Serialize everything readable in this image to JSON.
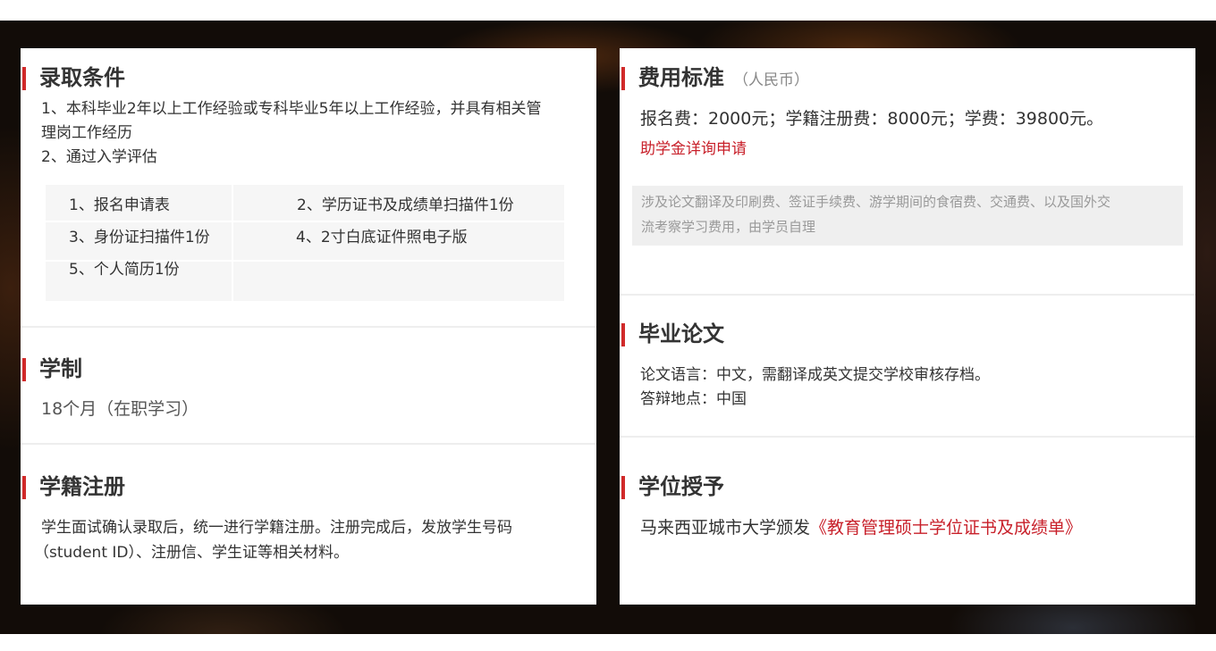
{
  "left": {
    "admission": {
      "title": "录取条件",
      "lines": [
        "1、本科毕业2年以上工作经验或专科毕业5年以上工作经验，并具有相关管",
        "理岗工作经历",
        "2、通过入学评估"
      ],
      "materials": [
        "1、报名申请表",
        "2、学历证书及成绩单扫描件1份",
        "3、身份证扫描件1份",
        "4、2寸白底证件照电子版",
        "5、个人简历1份"
      ]
    },
    "duration": {
      "title": "学制",
      "text": "18个月（在职学习）"
    },
    "registration": {
      "title": "学籍注册",
      "lines": [
        "学生面试确认录取后，统一进行学籍注册。注册完成后，发放学生号码",
        "（student ID）、注册信、学生证等相关材料。"
      ]
    }
  },
  "right": {
    "fees": {
      "title": "费用标准",
      "subtitle": "（人民币）",
      "line": "报名费：2000元；学籍注册费：8000元；学费：39800元。",
      "scholarship_link": "助学金详询申请",
      "note_lines": [
        "涉及论文翻译及印刷费、签证手续费、游学期间的食宿费、交通费、以及国外交",
        "流考察学习费用，由学员自理"
      ]
    },
    "thesis": {
      "title": "毕业论文",
      "lines": [
        "论文语言：中文，需翻译成英文提交学校审核存档。",
        "答辩地点：中国"
      ]
    },
    "degree": {
      "title": "学位授予",
      "prefix": "马来西亚城市大学颁发",
      "highlight": "《教育管理硕士学位证书及成绩单》"
    }
  },
  "colors": {
    "accent": "#d12a2a",
    "link": "#c8202a",
    "background_dark": "#120c08"
  }
}
